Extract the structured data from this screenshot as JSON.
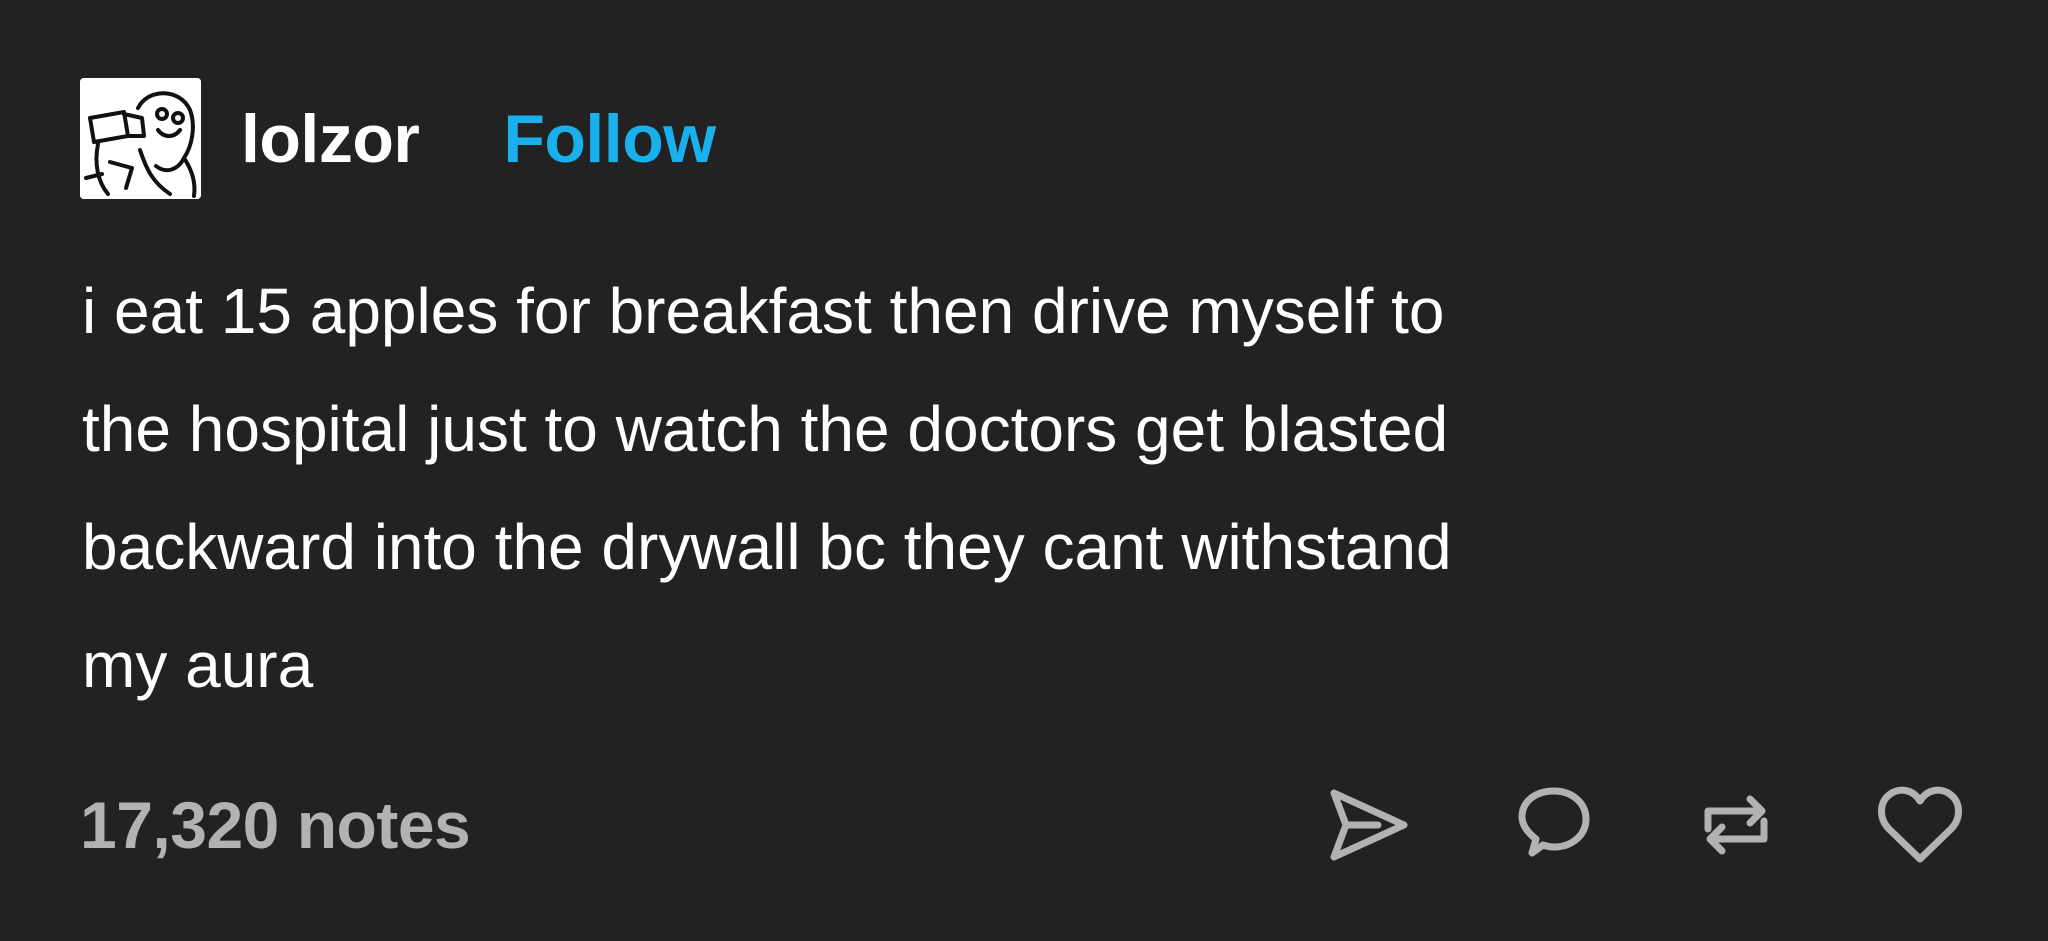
{
  "post": {
    "author": {
      "username": "lolzor",
      "follow_label": "Follow",
      "avatar_icon": "drawn-character-avatar"
    },
    "body_lines": [
      "i eat 15 apples for breakfast then drive myself to",
      "the hospital just to watch the doctors get blasted",
      "backward into the drywall bc they cant withstand",
      "my aura"
    ],
    "notes_label": "17,320 notes",
    "actions": [
      {
        "icon": "share-icon"
      },
      {
        "icon": "reply-icon"
      },
      {
        "icon": "reblog-icon"
      },
      {
        "icon": "like-icon"
      }
    ]
  },
  "colors": {
    "background": "#222222",
    "text": "#ffffff",
    "follow": "#1ab0ee",
    "muted": "#b2b2b2"
  }
}
